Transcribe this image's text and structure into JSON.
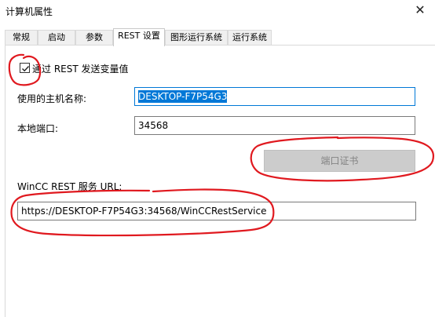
{
  "window": {
    "title": "计算机属性",
    "close_glyph": "✕"
  },
  "tabs": [
    {
      "label": "常规"
    },
    {
      "label": "启动"
    },
    {
      "label": "参数"
    },
    {
      "label": "REST 设置",
      "active": true
    },
    {
      "label": "图形运行系统"
    },
    {
      "label": "运行系统"
    }
  ],
  "rest": {
    "enable_label": "通过 REST 发送变量值",
    "enable_checked": true,
    "host_label": "使用的主机名称:",
    "host_value": "DESKTOP-F7P54G3",
    "port_label": "本地端口:",
    "port_value": "34568",
    "cert_button": "端口证书",
    "url_label": "WinCC REST 服务 URL:",
    "url_value": "https://DESKTOP-F7P54G3:34568/WinCCRestService"
  },
  "colors": {
    "annotation": "#e0191f",
    "selection": "#0078d7",
    "button_disabled": "#cccccc"
  }
}
